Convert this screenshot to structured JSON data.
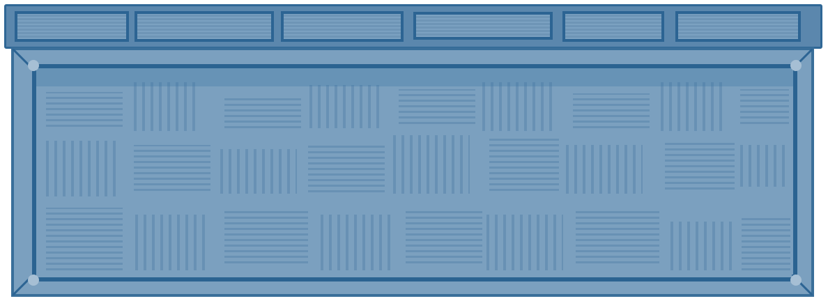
{
  "scene": {
    "colors": {
      "frame_dark": "#2c6493",
      "frame_mid": "#5b87ad",
      "fill_light": "#7ba0bf",
      "corner_knob": "#a6bfd4"
    },
    "rail_panels": [
      "panel-1",
      "panel-2",
      "panel-3",
      "panel-4",
      "panel-5",
      "panel-6"
    ]
  }
}
